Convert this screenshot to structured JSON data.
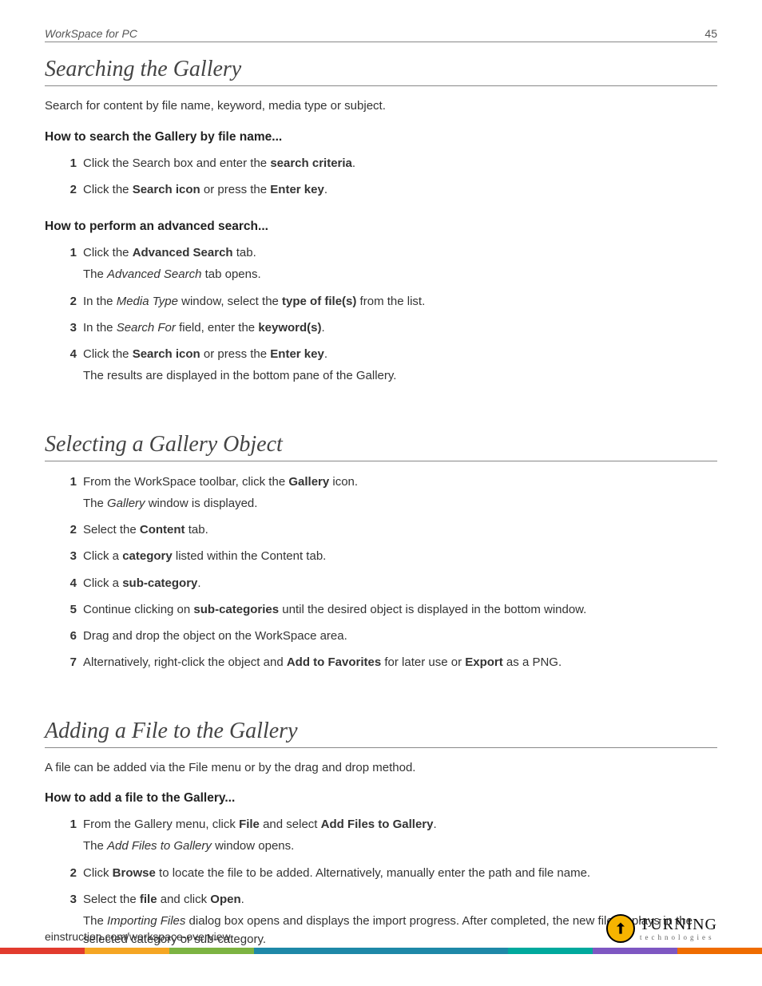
{
  "header": {
    "title": "WorkSpace for PC",
    "page": "45"
  },
  "section1": {
    "heading": "Searching the Gallery",
    "intro": "Search for content by file name, keyword, media type or subject.",
    "sub1": {
      "heading": "How to search the Gallery by file name...",
      "steps": [
        {
          "n": "1",
          "pre": "Click the Search box and enter the ",
          "b1": "search criteria",
          "post": "."
        },
        {
          "n": "2",
          "pre": "Click the ",
          "b1": "Search icon",
          "mid": " or press the ",
          "b2": "Enter key",
          "post": "."
        }
      ]
    },
    "sub2": {
      "heading": "How to perform an advanced search...",
      "steps": [
        {
          "n": "1",
          "pre": "Click the ",
          "b1": "Advanced Search",
          "post": " tab.",
          "sub_pre": "The ",
          "sub_i": "Advanced Search",
          "sub_post": " tab opens."
        },
        {
          "n": "2",
          "pre": "In the ",
          "i1": "Media Type",
          "mid": " window, select the ",
          "b1": "type of file(s)",
          "post": " from the list."
        },
        {
          "n": "3",
          "pre": "In the ",
          "i1": "Search For",
          "mid": " field, enter the ",
          "b1": "keyword(s)",
          "post": "."
        },
        {
          "n": "4",
          "pre": "Click the ",
          "b1": "Search icon",
          "mid": " or press the ",
          "b2": "Enter key",
          "post": ".",
          "sub_plain": "The results are displayed in the bottom pane of the Gallery."
        }
      ]
    }
  },
  "section2": {
    "heading": "Selecting a Gallery Object",
    "steps": [
      {
        "n": "1",
        "pre": "From the WorkSpace toolbar, click the ",
        "b1": "Gallery",
        "post": " icon.",
        "sub_pre": "The ",
        "sub_i": "Gallery",
        "sub_post": " window is displayed."
      },
      {
        "n": "2",
        "pre": "Select the ",
        "b1": "Content",
        "post": " tab."
      },
      {
        "n": "3",
        "pre": "Click a ",
        "b1": "category",
        "post": " listed within the Content tab."
      },
      {
        "n": "4",
        "pre": "Click a ",
        "b1": "sub-category",
        "post": "."
      },
      {
        "n": "5",
        "pre": "Continue clicking on ",
        "b1": "sub-categories",
        "post": " until the desired object is displayed in the bottom window."
      },
      {
        "n": "6",
        "plain": "Drag and drop the object on the WorkSpace area."
      },
      {
        "n": "7",
        "pre": "Alternatively, right-click the object and ",
        "b1": "Add to Favorites",
        "mid": " for later use or ",
        "b2": "Export",
        "post": " as a PNG."
      }
    ]
  },
  "section3": {
    "heading": "Adding a File to the Gallery",
    "intro": "A file can be added via the File menu or by the drag and drop method.",
    "sub1": {
      "heading": "How to add a file to the Gallery...",
      "steps": [
        {
          "n": "1",
          "pre": "From the Gallery menu, click ",
          "b1": "File",
          "mid": " and select ",
          "b2": "Add Files to Gallery",
          "post": ".",
          "sub_pre": "The ",
          "sub_i": "Add Files to Gallery",
          "sub_post": " window opens."
        },
        {
          "n": "2",
          "pre": "Click ",
          "b1": "Browse",
          "post": " to locate the file to be added. Alternatively, manually enter the path and file name."
        },
        {
          "n": "3",
          "pre": "Select the ",
          "b1": "file",
          "mid": " and click ",
          "b2": "Open",
          "post": ".",
          "sub_pre": "The ",
          "sub_i": "Importing Files",
          "sub_post": " dialog box opens and displays the import progress. After completed, the new file displays in the selected category or sub-category."
        }
      ]
    }
  },
  "footer": {
    "url": "einstruction.com/workspace-overview",
    "logo_big": "TURNING",
    "logo_small": "technologies"
  }
}
